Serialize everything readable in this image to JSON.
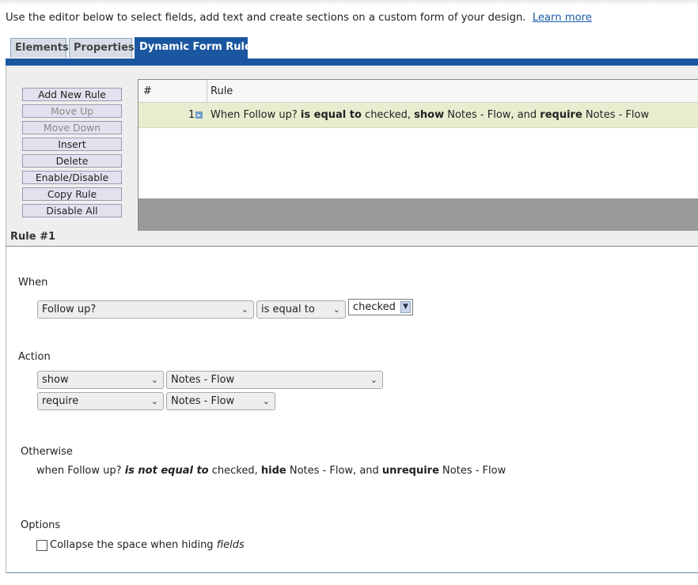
{
  "intro": {
    "text": "Use the editor below to select fields, add text and create sections on a custom form of your design.",
    "link": "Learn more"
  },
  "tabs": [
    {
      "label": "Elements"
    },
    {
      "label": "Properties"
    },
    {
      "label": "Dynamic Form Rules"
    }
  ],
  "toolbar": {
    "buttons": [
      {
        "label": "Add New Rule"
      },
      {
        "label": "Move Up"
      },
      {
        "label": "Move Down"
      },
      {
        "label": "Insert"
      },
      {
        "label": "Delete"
      },
      {
        "label": "Enable/Disable"
      },
      {
        "label": "Copy Rule"
      },
      {
        "label": "Disable All"
      }
    ]
  },
  "grid": {
    "columns": [
      "#",
      "Rule"
    ],
    "rows": [
      {
        "num": "1",
        "parts": [
          "When Follow up?",
          "is equal to",
          "checked,",
          "show",
          "Notes - Flow, and",
          "require",
          "Notes - Flow"
        ]
      }
    ]
  },
  "rule": {
    "title": "Rule #1",
    "when_label": "When",
    "when": {
      "field": "Follow up?",
      "operator": "is equal to",
      "value": "checked"
    },
    "action_label": "Action",
    "actions": [
      {
        "verb": "show",
        "target": "Notes - Flow"
      },
      {
        "verb": "require",
        "target": "Notes - Flow"
      }
    ],
    "otherwise_label": "Otherwise",
    "otherwise_parts": [
      "when Follow up?",
      "is not equal to",
      "checked,",
      "hide",
      "Notes - Flow, and",
      "unrequire",
      "Notes - Flow"
    ],
    "options_label": "Options",
    "collapse_text": "Collapse the space when hiding",
    "collapse_em": "fields"
  }
}
